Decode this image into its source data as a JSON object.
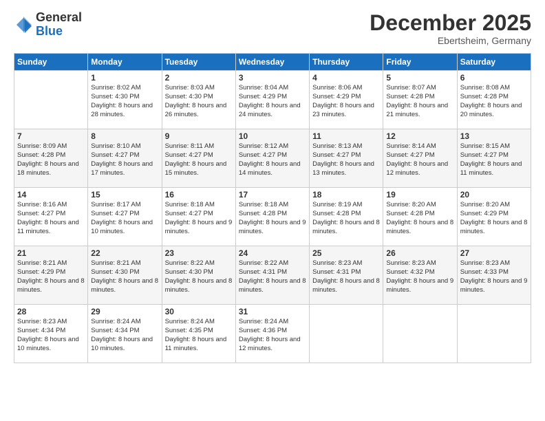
{
  "header": {
    "logo": {
      "general": "General",
      "blue": "Blue"
    },
    "title": "December 2025",
    "subtitle": "Ebertsheim, Germany"
  },
  "days_of_week": [
    "Sunday",
    "Monday",
    "Tuesday",
    "Wednesday",
    "Thursday",
    "Friday",
    "Saturday"
  ],
  "weeks": [
    [
      {
        "day": "",
        "sunrise": "",
        "sunset": "",
        "daylight": ""
      },
      {
        "day": "1",
        "sunrise": "Sunrise: 8:02 AM",
        "sunset": "Sunset: 4:30 PM",
        "daylight": "Daylight: 8 hours and 28 minutes."
      },
      {
        "day": "2",
        "sunrise": "Sunrise: 8:03 AM",
        "sunset": "Sunset: 4:30 PM",
        "daylight": "Daylight: 8 hours and 26 minutes."
      },
      {
        "day": "3",
        "sunrise": "Sunrise: 8:04 AM",
        "sunset": "Sunset: 4:29 PM",
        "daylight": "Daylight: 8 hours and 24 minutes."
      },
      {
        "day": "4",
        "sunrise": "Sunrise: 8:06 AM",
        "sunset": "Sunset: 4:29 PM",
        "daylight": "Daylight: 8 hours and 23 minutes."
      },
      {
        "day": "5",
        "sunrise": "Sunrise: 8:07 AM",
        "sunset": "Sunset: 4:28 PM",
        "daylight": "Daylight: 8 hours and 21 minutes."
      },
      {
        "day": "6",
        "sunrise": "Sunrise: 8:08 AM",
        "sunset": "Sunset: 4:28 PM",
        "daylight": "Daylight: 8 hours and 20 minutes."
      }
    ],
    [
      {
        "day": "7",
        "sunrise": "Sunrise: 8:09 AM",
        "sunset": "Sunset: 4:28 PM",
        "daylight": "Daylight: 8 hours and 18 minutes."
      },
      {
        "day": "8",
        "sunrise": "Sunrise: 8:10 AM",
        "sunset": "Sunset: 4:27 PM",
        "daylight": "Daylight: 8 hours and 17 minutes."
      },
      {
        "day": "9",
        "sunrise": "Sunrise: 8:11 AM",
        "sunset": "Sunset: 4:27 PM",
        "daylight": "Daylight: 8 hours and 15 minutes."
      },
      {
        "day": "10",
        "sunrise": "Sunrise: 8:12 AM",
        "sunset": "Sunset: 4:27 PM",
        "daylight": "Daylight: 8 hours and 14 minutes."
      },
      {
        "day": "11",
        "sunrise": "Sunrise: 8:13 AM",
        "sunset": "Sunset: 4:27 PM",
        "daylight": "Daylight: 8 hours and 13 minutes."
      },
      {
        "day": "12",
        "sunrise": "Sunrise: 8:14 AM",
        "sunset": "Sunset: 4:27 PM",
        "daylight": "Daylight: 8 hours and 12 minutes."
      },
      {
        "day": "13",
        "sunrise": "Sunrise: 8:15 AM",
        "sunset": "Sunset: 4:27 PM",
        "daylight": "Daylight: 8 hours and 11 minutes."
      }
    ],
    [
      {
        "day": "14",
        "sunrise": "Sunrise: 8:16 AM",
        "sunset": "Sunset: 4:27 PM",
        "daylight": "Daylight: 8 hours and 11 minutes."
      },
      {
        "day": "15",
        "sunrise": "Sunrise: 8:17 AM",
        "sunset": "Sunset: 4:27 PM",
        "daylight": "Daylight: 8 hours and 10 minutes."
      },
      {
        "day": "16",
        "sunrise": "Sunrise: 8:18 AM",
        "sunset": "Sunset: 4:27 PM",
        "daylight": "Daylight: 8 hours and 9 minutes."
      },
      {
        "day": "17",
        "sunrise": "Sunrise: 8:18 AM",
        "sunset": "Sunset: 4:28 PM",
        "daylight": "Daylight: 8 hours and 9 minutes."
      },
      {
        "day": "18",
        "sunrise": "Sunrise: 8:19 AM",
        "sunset": "Sunset: 4:28 PM",
        "daylight": "Daylight: 8 hours and 8 minutes."
      },
      {
        "day": "19",
        "sunrise": "Sunrise: 8:20 AM",
        "sunset": "Sunset: 4:28 PM",
        "daylight": "Daylight: 8 hours and 8 minutes."
      },
      {
        "day": "20",
        "sunrise": "Sunrise: 8:20 AM",
        "sunset": "Sunset: 4:29 PM",
        "daylight": "Daylight: 8 hours and 8 minutes."
      }
    ],
    [
      {
        "day": "21",
        "sunrise": "Sunrise: 8:21 AM",
        "sunset": "Sunset: 4:29 PM",
        "daylight": "Daylight: 8 hours and 8 minutes."
      },
      {
        "day": "22",
        "sunrise": "Sunrise: 8:21 AM",
        "sunset": "Sunset: 4:30 PM",
        "daylight": "Daylight: 8 hours and 8 minutes."
      },
      {
        "day": "23",
        "sunrise": "Sunrise: 8:22 AM",
        "sunset": "Sunset: 4:30 PM",
        "daylight": "Daylight: 8 hours and 8 minutes."
      },
      {
        "day": "24",
        "sunrise": "Sunrise: 8:22 AM",
        "sunset": "Sunset: 4:31 PM",
        "daylight": "Daylight: 8 hours and 8 minutes."
      },
      {
        "day": "25",
        "sunrise": "Sunrise: 8:23 AM",
        "sunset": "Sunset: 4:31 PM",
        "daylight": "Daylight: 8 hours and 8 minutes."
      },
      {
        "day": "26",
        "sunrise": "Sunrise: 8:23 AM",
        "sunset": "Sunset: 4:32 PM",
        "daylight": "Daylight: 8 hours and 9 minutes."
      },
      {
        "day": "27",
        "sunrise": "Sunrise: 8:23 AM",
        "sunset": "Sunset: 4:33 PM",
        "daylight": "Daylight: 8 hours and 9 minutes."
      }
    ],
    [
      {
        "day": "28",
        "sunrise": "Sunrise: 8:23 AM",
        "sunset": "Sunset: 4:34 PM",
        "daylight": "Daylight: 8 hours and 10 minutes."
      },
      {
        "day": "29",
        "sunrise": "Sunrise: 8:24 AM",
        "sunset": "Sunset: 4:34 PM",
        "daylight": "Daylight: 8 hours and 10 minutes."
      },
      {
        "day": "30",
        "sunrise": "Sunrise: 8:24 AM",
        "sunset": "Sunset: 4:35 PM",
        "daylight": "Daylight: 8 hours and 11 minutes."
      },
      {
        "day": "31",
        "sunrise": "Sunrise: 8:24 AM",
        "sunset": "Sunset: 4:36 PM",
        "daylight": "Daylight: 8 hours and 12 minutes."
      },
      {
        "day": "",
        "sunrise": "",
        "sunset": "",
        "daylight": ""
      },
      {
        "day": "",
        "sunrise": "",
        "sunset": "",
        "daylight": ""
      },
      {
        "day": "",
        "sunrise": "",
        "sunset": "",
        "daylight": ""
      }
    ]
  ]
}
